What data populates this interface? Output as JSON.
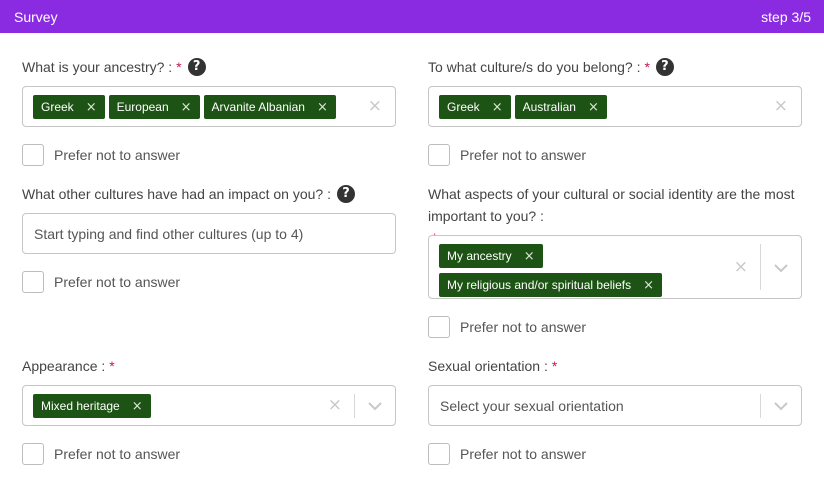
{
  "header": {
    "title": "Survey",
    "step": "step 3/5"
  },
  "prefer_not_label": "Prefer not to answer",
  "required_mark": "*",
  "help_glyph": "?",
  "remove_glyph": "×",
  "ancestry": {
    "label": "What is your ancestry? :",
    "tags": [
      "Greek",
      "European",
      "Arvanite Albanian"
    ]
  },
  "culture": {
    "label": "To what culture/s do you belong? :",
    "tags": [
      "Greek",
      "Australian"
    ]
  },
  "other_cultures": {
    "label": "What other cultures have had an impact on you? :",
    "placeholder": "Start typing and find other cultures (up to 4)"
  },
  "identity": {
    "label": "What aspects of your cultural or social identity are the most important to you? :",
    "tags": [
      "My ancestry",
      "My religious and/or spiritual beliefs"
    ]
  },
  "appearance": {
    "label": "Appearance :",
    "tags": [
      "Mixed heritage"
    ]
  },
  "sexual_orientation": {
    "label": "Sexual orientation :",
    "placeholder": "Select your sexual orientation"
  }
}
